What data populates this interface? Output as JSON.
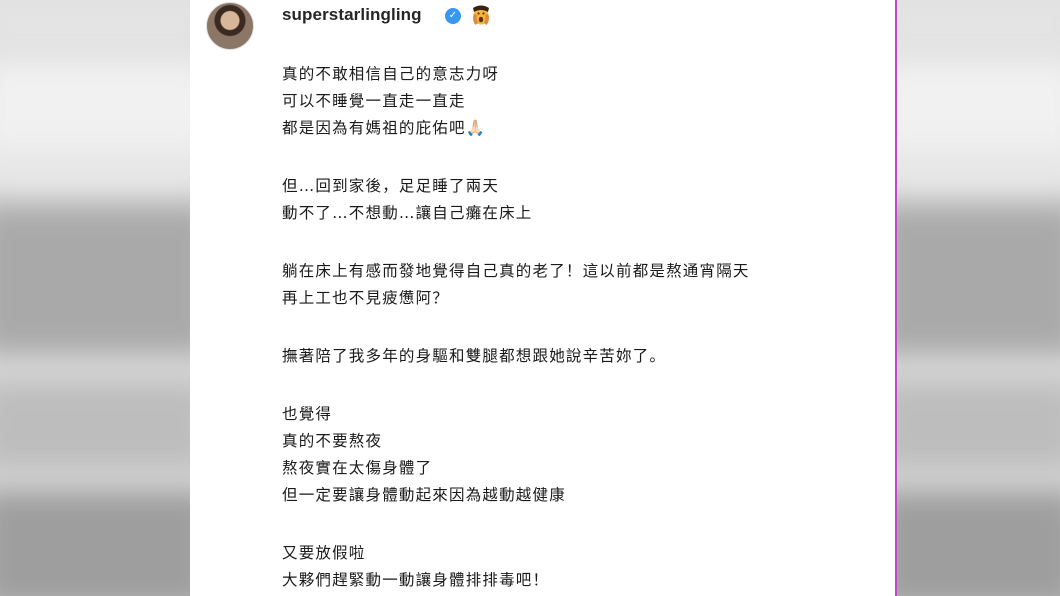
{
  "post": {
    "username": "superstarlingling",
    "verified_icon": "verified-badge-icon",
    "emoji_icon": "face-with-hands-icon",
    "avatar_icon": "profile-avatar",
    "colors": {
      "verified": "#3897f0",
      "text": "#262626",
      "divider": "#c247c9"
    },
    "caption": {
      "p1": [
        "真的不敢相信自己的意志力呀",
        "可以不睡覺一直走一直走",
        "都是因為有媽祖的庇佑吧🙏🏻"
      ],
      "p2": [
        "但…回到家後，足足睡了兩天",
        "動不了…不想動…讓自己癱在床上"
      ],
      "p3": [
        "躺在床上有感而發地覺得自己真的老了！這以前都是熬通宵隔天",
        "再上工也不見疲憊阿？"
      ],
      "p4": [
        "撫著陪了我多年的身驅和雙腿都想跟她說辛苦妳了。"
      ],
      "p5": [
        "也覺得",
        "真的不要熬夜",
        "熬夜實在太傷身體了",
        "但一定要讓身體動起來因為越動越健康"
      ],
      "p6": [
        "又要放假啦",
        "大夥們趕緊動一動讓身體排排毒吧！"
      ]
    }
  }
}
